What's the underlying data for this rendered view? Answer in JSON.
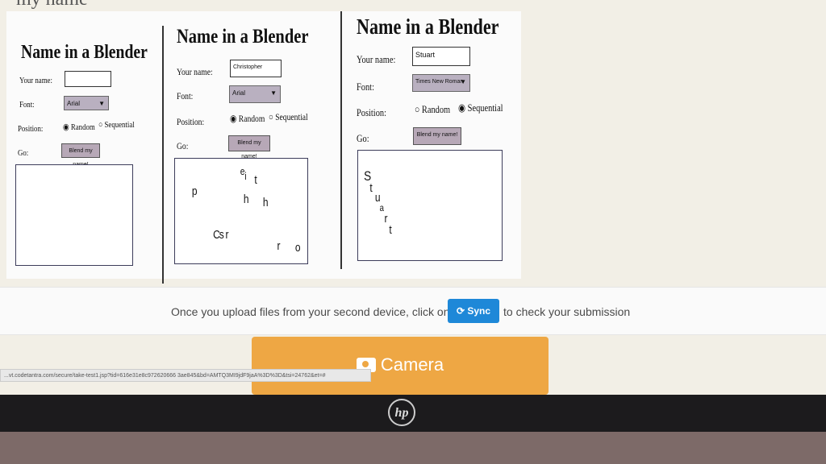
{
  "page": {
    "top_heading": "my name"
  },
  "blenders": [
    {
      "title": "Name in a Blender",
      "name_label": "Your name:",
      "name_value": "",
      "font_label": "Font:",
      "font_value": "Arial",
      "position_label": "Position:",
      "radio_random": "Random",
      "radio_sequential": "Sequential",
      "selected_position": "Random",
      "go_label": "Go:",
      "button_label": "Blend my name!",
      "output_letters": []
    },
    {
      "title": "Name in a Blender",
      "name_label": "Your name:",
      "name_value": "Christopher",
      "font_label": "Font:",
      "font_value": "Arial",
      "position_label": "Position:",
      "radio_random": "Random",
      "radio_sequential": "Sequential",
      "selected_position": "Random",
      "go_label": "Go:",
      "button_label": "Blend my name!",
      "output_letters": [
        "p",
        "e",
        "i",
        "t",
        "h",
        "h",
        "C",
        "s",
        "r",
        "r",
        "o"
      ]
    },
    {
      "title": "Name in a Blender",
      "name_label": "Your name:",
      "name_value": "Stuart",
      "font_label": "Font:",
      "font_value": "Times New Roman",
      "position_label": "Position:",
      "radio_random": "Random",
      "radio_sequential": "Sequential",
      "selected_position": "Sequential",
      "go_label": "Go:",
      "button_label": "Blend my name!",
      "output_letters": [
        "S",
        "t",
        "u",
        "a",
        "r",
        "t"
      ]
    }
  ],
  "sync_bar": {
    "text_before": "Once you upload files from your second device, click on",
    "button_label": "Sync",
    "text_after": "to check your submission"
  },
  "camera_button": {
    "label": "Camera",
    "icon": "camera-icon"
  },
  "status_url": "...vt.codetantra.com/secure/take-test1.jsp?tid=616e31e8c972620666 3ae845&bd=AMTQ3MI9jdF9jaA%3D%3D&tsi=24762&et=#",
  "bezel": {
    "logo": "hp"
  },
  "colors": {
    "sync_button": "#1e88d8",
    "camera_button": "#eea744",
    "page_background": "#f2efe6"
  }
}
